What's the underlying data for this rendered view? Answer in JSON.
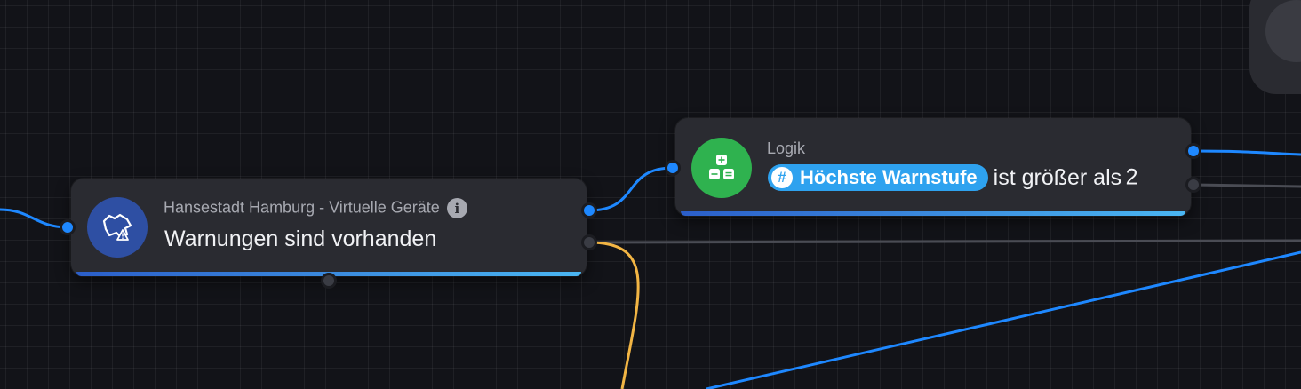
{
  "node_device": {
    "source": "Hansestadt Hamburg - Virtuelle Geräte",
    "title": "Warnungen sind vorhanden",
    "info_glyph": "i",
    "icon": "hamburg-map-warning-icon"
  },
  "node_logic": {
    "category": "Logik",
    "variable": "Höchste Warnstufe",
    "variable_glyph": "#",
    "comparison": "ist größer als",
    "value": "2",
    "icon": "logic-operators-icon"
  },
  "colors": {
    "background": "#121318",
    "card": "#2a2b31",
    "wire_blue": "#1e88ff",
    "wire_gray": "#4a4c54",
    "wire_yellow": "#f2b544",
    "device_icon_bg": "#2e4fa3",
    "logic_icon_bg": "#2fb24f",
    "chip": "#2ea2ef"
  }
}
